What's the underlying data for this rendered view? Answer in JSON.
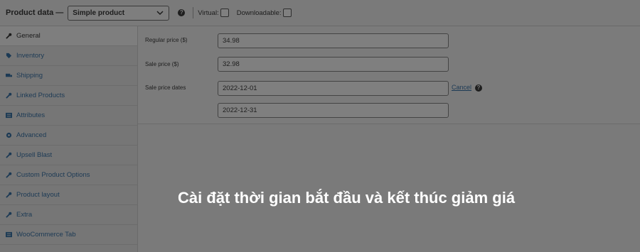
{
  "header": {
    "title": "Product data —",
    "product_type": "Simple product",
    "virtual_label": "Virtual:",
    "downloadable_label": "Downloadable:"
  },
  "sidebar": {
    "items": [
      {
        "label": "General",
        "icon": "wrench-icon",
        "active": true
      },
      {
        "label": "Inventory",
        "icon": "tag-icon"
      },
      {
        "label": "Shipping",
        "icon": "truck-icon"
      },
      {
        "label": "Linked Products",
        "icon": "link-icon"
      },
      {
        "label": "Attributes",
        "icon": "list-icon"
      },
      {
        "label": "Advanced",
        "icon": "gear-icon"
      },
      {
        "label": "Upsell Blast",
        "icon": "wrench-icon"
      },
      {
        "label": "Custom Product Options",
        "icon": "wrench-icon"
      },
      {
        "label": "Product layout",
        "icon": "wrench-icon"
      },
      {
        "label": "Extra",
        "icon": "wrench-icon"
      },
      {
        "label": "WooCommerce Tab",
        "icon": "list-icon"
      }
    ]
  },
  "general": {
    "regular_price_label": "Regular price ($)",
    "regular_price_value": "34.98",
    "sale_price_label": "Sale price ($)",
    "sale_price_value": "32.98",
    "sale_dates_label": "Sale price dates",
    "sale_date_from": "2022-12-01",
    "sale_date_to": "2022-12-31",
    "cancel_label": "Cancel"
  },
  "caption": "Cài đặt thời gian bắt đầu và kết thúc giảm giá",
  "colors": {
    "overlay_bg": "#7a7a7a",
    "link": "#1c3a55",
    "caption_text": "#ffffff"
  }
}
